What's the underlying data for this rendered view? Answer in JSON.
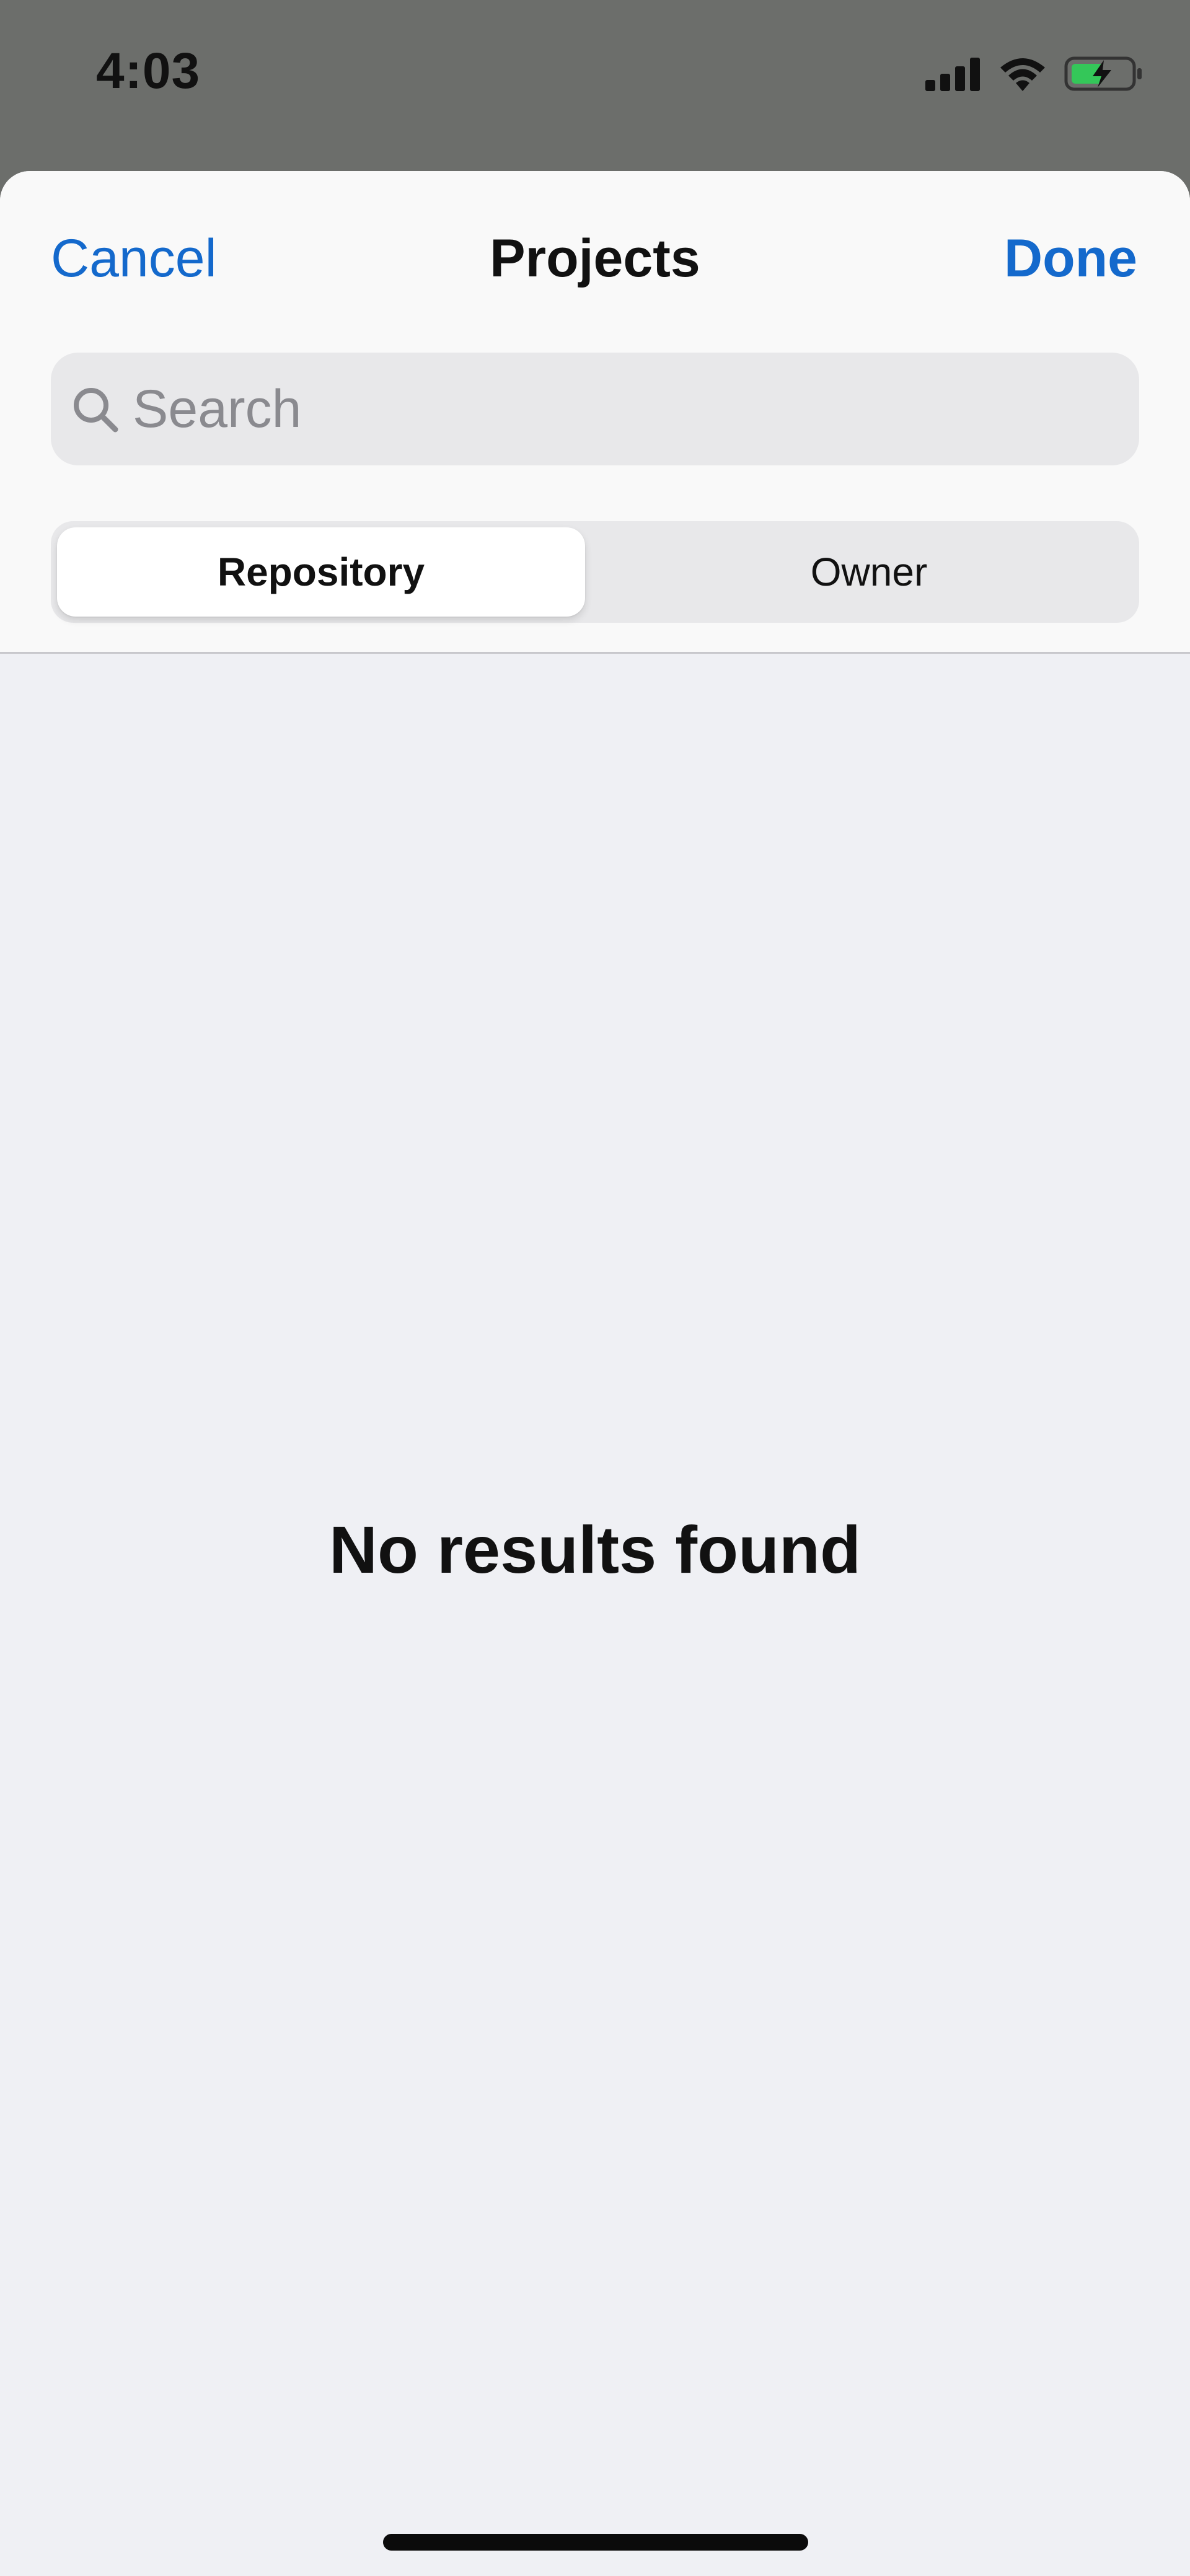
{
  "status_bar": {
    "time": "4:03",
    "icons": [
      "signal-icon",
      "wifi-icon",
      "battery-charging-icon"
    ]
  },
  "nav": {
    "cancel_label": "Cancel",
    "title": "Projects",
    "done_label": "Done"
  },
  "search": {
    "placeholder": "Search",
    "value": ""
  },
  "segments": [
    {
      "label": "Repository",
      "selected": true
    },
    {
      "label": "Owner",
      "selected": false
    }
  ],
  "empty_state": {
    "message": "No results found"
  },
  "colors": {
    "accent": "#1469cc",
    "battery_fill": "#34c759",
    "sheet_background": "#eff0f4",
    "backdrop": "#6c6e6b"
  }
}
